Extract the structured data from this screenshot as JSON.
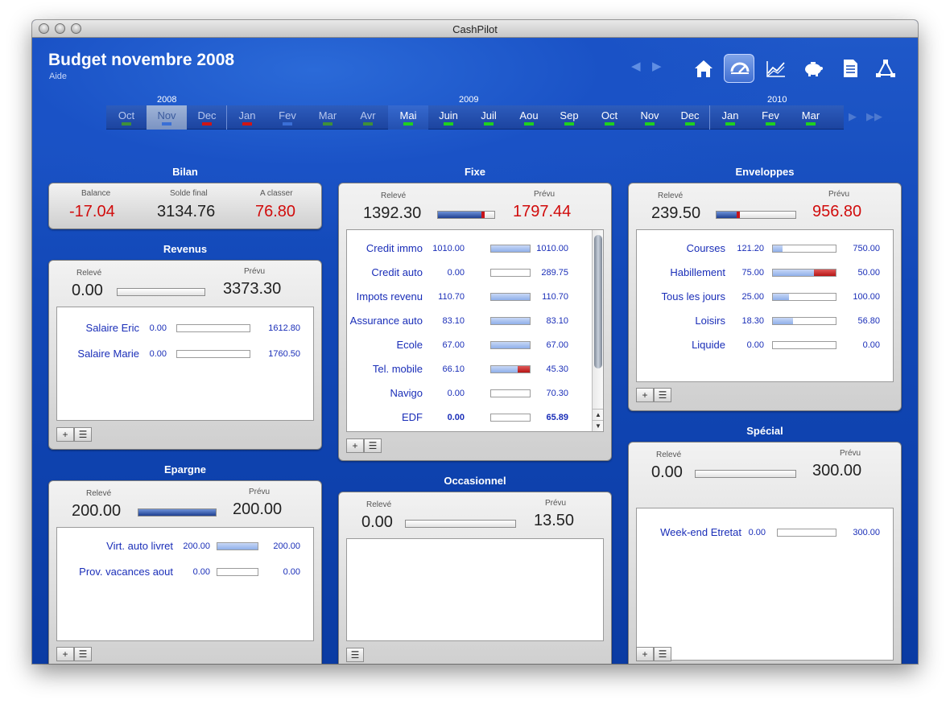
{
  "window": {
    "title": "CashPilot"
  },
  "header": {
    "title": "Budget novembre 2008",
    "help": "Aide"
  },
  "nav": {
    "back": "◀",
    "forward": "▶"
  },
  "toolbar": {
    "icons": [
      "home-icon",
      "budget-gauge-icon",
      "chart-icon",
      "piggy-bank-icon",
      "document-icon",
      "network-icon"
    ],
    "active": "budget-gauge-icon"
  },
  "timeline": {
    "years": [
      "2008",
      "2009",
      "2010"
    ],
    "months": [
      {
        "label": "Oct",
        "bar": "#3f8f3a"
      },
      {
        "label": "Nov",
        "bar": "#3a6fd6",
        "selected": true
      },
      {
        "label": "Dec",
        "bar": "#d01515"
      },
      {
        "label": "Jan",
        "bar": "#d01515"
      },
      {
        "label": "Fev",
        "bar": "#3a6fd6"
      },
      {
        "label": "Mar",
        "bar": "#3f8f3a"
      },
      {
        "label": "Avr",
        "bar": "#3f8f3a"
      },
      {
        "label": "Mai",
        "bar": "#20d020",
        "current": true
      },
      {
        "label": "Juin",
        "bar": "#20d020"
      },
      {
        "label": "Juil",
        "bar": "#20d020"
      },
      {
        "label": "Aou",
        "bar": "#20d020"
      },
      {
        "label": "Sep",
        "bar": "#20d020"
      },
      {
        "label": "Oct",
        "bar": "#20d020"
      },
      {
        "label": "Nov",
        "bar": "#20d020"
      },
      {
        "label": "Dec",
        "bar": "#20d020"
      },
      {
        "label": "Jan",
        "bar": "#20d020"
      },
      {
        "label": "Fev",
        "bar": "#20d020"
      },
      {
        "label": "Mar",
        "bar": "#20d020"
      }
    ],
    "forward": "▶",
    "fast_forward": "▶▶"
  },
  "colors": {
    "accent_blue": "#1a2eb8",
    "negative_red": "#d10c0c",
    "background": "#1248b8"
  },
  "bilan": {
    "title": "Bilan",
    "balance_label": "Balance",
    "balance": "-17.04",
    "solde_label": "Solde final",
    "solde": "3134.76",
    "classer_label": "A classer",
    "classer": "76.80"
  },
  "revenus": {
    "title": "Revenus",
    "releve_label": "Relevé",
    "releve": "0.00",
    "prevu_label": "Prévu",
    "prevu": "3373.30",
    "progress": 0,
    "rows": [
      {
        "name": "Salaire Eric",
        "releve": "0.00",
        "prevu": "1612.80",
        "progress": 0
      },
      {
        "name": "Salaire Marie",
        "releve": "0.00",
        "prevu": "1760.50",
        "progress": 0
      }
    ]
  },
  "epargne": {
    "title": "Epargne",
    "releve_label": "Relevé",
    "releve": "200.00",
    "prevu_label": "Prévu",
    "prevu": "200.00",
    "progress": 1,
    "rows": [
      {
        "name": "Virt. auto livret",
        "releve": "200.00",
        "prevu": "200.00",
        "progress": 1
      },
      {
        "name": "Prov. vacances aout",
        "releve": "0.00",
        "prevu": "0.00",
        "progress": 0
      }
    ]
  },
  "fixe": {
    "title": "Fixe",
    "releve_label": "Relevé",
    "releve": "1392.30",
    "prevu_label": "Prévu",
    "prevu": "1797.44",
    "progress": 0.77,
    "rows": [
      {
        "name": "Credit immo",
        "releve": "1010.00",
        "prevu": "1010.00",
        "progress": 1
      },
      {
        "name": "Credit auto",
        "releve": "0.00",
        "prevu": "289.75",
        "progress": 0
      },
      {
        "name": "Impots revenu",
        "releve": "110.70",
        "prevu": "110.70",
        "progress": 1
      },
      {
        "name": "Assurance auto",
        "releve": "83.10",
        "prevu": "83.10",
        "progress": 1
      },
      {
        "name": "Ecole",
        "releve": "67.00",
        "prevu": "67.00",
        "progress": 1
      },
      {
        "name": "Tel. mobile",
        "releve": "66.10",
        "prevu": "45.30",
        "progress": 0.68,
        "over": true
      },
      {
        "name": "Navigo",
        "releve": "0.00",
        "prevu": "70.30",
        "progress": 0
      },
      {
        "name": "EDF",
        "releve": "0.00",
        "prevu": "65.89",
        "progress": 0,
        "bold": true
      }
    ]
  },
  "occasionnel": {
    "title": "Occasionnel",
    "releve_label": "Relevé",
    "releve": "0.00",
    "prevu_label": "Prévu",
    "prevu": "13.50",
    "progress": 0,
    "rows": []
  },
  "enveloppes": {
    "title": "Enveloppes",
    "releve_label": "Relevé",
    "releve": "239.50",
    "prevu_label": "Prévu",
    "prevu": "956.80",
    "progress": 0.25,
    "rows": [
      {
        "name": "Courses",
        "releve": "121.20",
        "prevu": "750.00",
        "progress": 0.16
      },
      {
        "name": "Habillement",
        "releve": "75.00",
        "prevu": "50.00",
        "progress": 0.66,
        "over": true
      },
      {
        "name": "Tous les jours",
        "releve": "25.00",
        "prevu": "100.00",
        "progress": 0.25
      },
      {
        "name": "Loisirs",
        "releve": "18.30",
        "prevu": "56.80",
        "progress": 0.32
      },
      {
        "name": "Liquide",
        "releve": "0.00",
        "prevu": "0.00",
        "progress": 0
      }
    ]
  },
  "special": {
    "title": "Spécial",
    "releve_label": "Relevé",
    "releve": "0.00",
    "prevu_label": "Prévu",
    "prevu": "300.00",
    "progress": 0,
    "rows": [
      {
        "name": "Week-end Etretat",
        "releve": "0.00",
        "prevu": "300.00",
        "progress": 0
      }
    ]
  },
  "buttons": {
    "add": "+",
    "menu": "☰"
  }
}
